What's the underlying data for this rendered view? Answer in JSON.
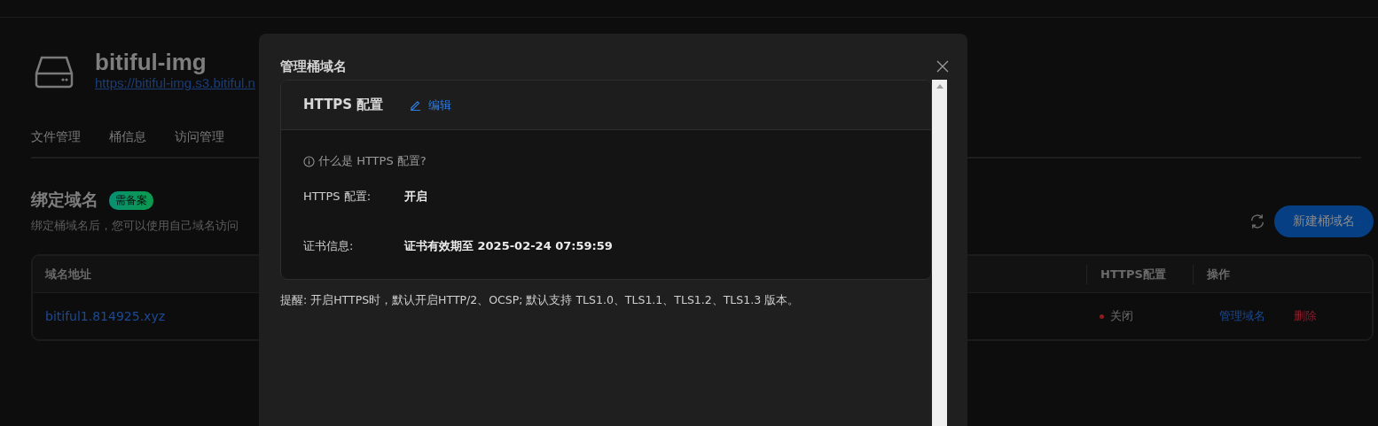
{
  "bucket": {
    "name": "bitiful-img",
    "url": "https://bitiful-img.s3.bitiful.n"
  },
  "tabs": [
    {
      "label": "文件管理",
      "selected": false
    },
    {
      "label": "桶信息",
      "selected": false
    },
    {
      "label": "访问管理",
      "selected": false
    }
  ],
  "section": {
    "title": "绑定域名",
    "badge": "需备案",
    "description": "绑定桶域名后，您可以使用自己域名访问",
    "new_button": "新建桶域名"
  },
  "table": {
    "columns": [
      "域名地址",
      "HTTPS配置",
      "操作"
    ],
    "rows": [
      {
        "domain": "bitiful1.814925.xyz",
        "https": {
          "label": "关闭",
          "on": false
        },
        "actions": [
          {
            "label": "管理域名",
            "kind": "link"
          },
          {
            "label": "删除",
            "kind": "danger"
          }
        ]
      }
    ]
  },
  "dialog": {
    "title": "管理桶域名",
    "card": {
      "title": "HTTPS 配置",
      "edit": "编辑",
      "help": "什么是 HTTPS 配置?",
      "fields": [
        {
          "label": "HTTPS 配置:",
          "value": "开启"
        },
        {
          "label": "证书信息:",
          "value": "证书有效期至 2025-02-24 07:59:59"
        }
      ]
    },
    "note": "提醒: 开启HTTPS时，默认开启HTTP/2、OCSP; 默认支持 TLS1.0、TLS1.1、TLS1.2、TLS1.3 版本。"
  }
}
